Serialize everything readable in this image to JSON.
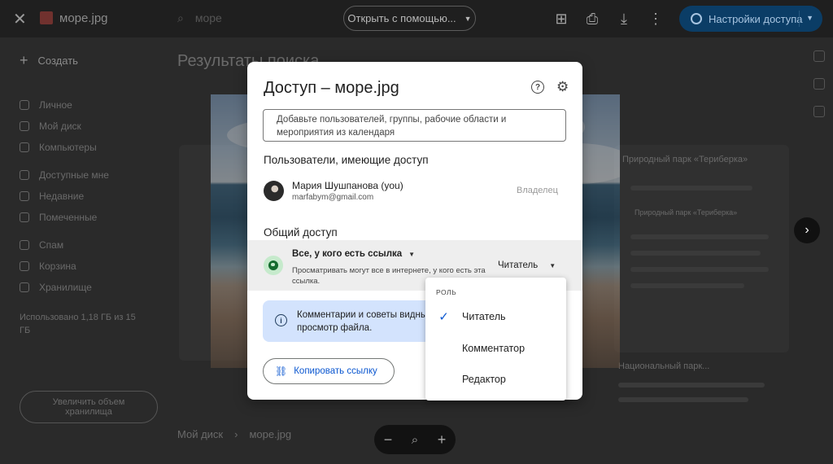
{
  "viewer": {
    "file_name": "море.jpg",
    "search_text": "море",
    "open_with_label": "Открыть с помощью...",
    "share_label": "Настройки доступа"
  },
  "background": {
    "create_label": "Создать",
    "nav": [
      "Личное",
      "Мой диск",
      "Компьютеры",
      "Доступные мне",
      "Недавние",
      "Помеченные",
      "Спам",
      "Корзина",
      "Хранилище"
    ],
    "storage_text": "Использовано 1,18 ГБ из 15 ГБ",
    "buy_storage_label": "Увеличить объем хранилища",
    "page_title": "Результаты поиска",
    "card1_title": "Природный парк «Териберка»",
    "card2_title": "Природный парк «Териберка»",
    "card3_title": "Национальный парк...",
    "breadcrumb_root": "Мой диск",
    "breadcrumb_file": "море.jpg"
  },
  "dialog": {
    "title": "Доступ – море.jpg",
    "add_people_placeholder": "Добавьте пользователей, группы, рабочие области и мероприятия из календаря",
    "people_section_title": "Пользователи, имеющие доступ",
    "owner": {
      "name": "Мария Шушпанова (you)",
      "email": "marfabym@gmail.com",
      "role": "Владелец"
    },
    "general_access_title": "Общий доступ",
    "general_access": {
      "mode": "Все, у кого есть ссылка",
      "description": "Просматривать могут все в интернете, у кого есть эта ссылка.",
      "role": "Читатель"
    },
    "info_text": "Комментарии и советы видны... просмотр файла.",
    "copy_link_label": "Копировать ссылку"
  },
  "role_menu": {
    "header": "РОЛЬ",
    "items": [
      {
        "label": "Читатель",
        "selected": true
      },
      {
        "label": "Комментатор",
        "selected": false
      },
      {
        "label": "Редактор",
        "selected": false
      }
    ]
  },
  "icons": {
    "close": "close-icon",
    "search": "search-icon",
    "add_to_drive": "add-to-drive-icon",
    "print": "print-icon",
    "download": "download-icon",
    "more": "more-vert-icon",
    "globe": "globe-icon",
    "help": "help-icon",
    "settings": "gear-icon",
    "info": "info-icon",
    "link": "link-icon",
    "check": "check-icon",
    "zoom_out": "zoom-out-icon",
    "zoom": "zoom-icon",
    "zoom_in": "zoom-in-icon",
    "next": "chevron-right-icon"
  },
  "colors": {
    "accent": "#0b57d0",
    "share_button": "#0b3d66",
    "info_box": "#d3e3fd",
    "access_globe": "#146c2e"
  }
}
